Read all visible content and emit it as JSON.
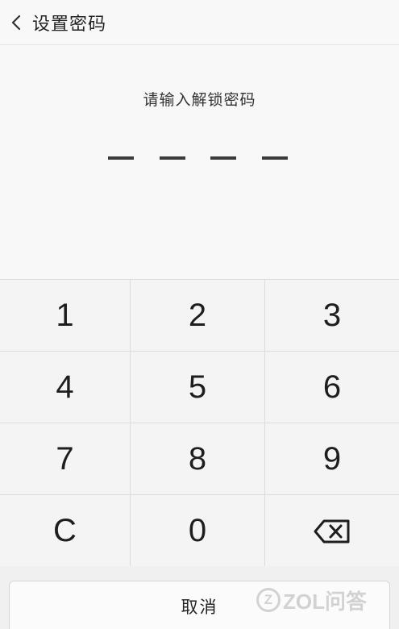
{
  "header": {
    "title": "设置密码",
    "back_icon": "chevron-left-icon"
  },
  "pin": {
    "prompt": "请输入解锁密码",
    "digits_entered": 0,
    "digits_total": 4
  },
  "keypad": {
    "keys": [
      "1",
      "2",
      "3",
      "4",
      "5",
      "6",
      "7",
      "8",
      "9",
      "C",
      "0"
    ],
    "backspace_icon": "backspace-icon"
  },
  "footer": {
    "cancel_label": "取消"
  },
  "watermark": {
    "text": "ZOL问答"
  }
}
